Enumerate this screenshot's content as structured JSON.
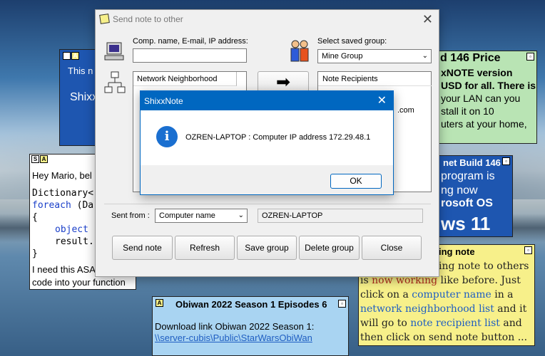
{
  "main_dialog": {
    "title": "Send note to other",
    "comp_label": "Comp. name, E-mail, IP address:",
    "comp_value": "",
    "saved_group_label": "Select saved group:",
    "saved_group_value": "Mine Group",
    "network_header": "Network Neighborhood",
    "recipients_header": "Note Recipients",
    "recipients_partial": ".com",
    "sent_from_label": "Sent from :",
    "sent_from_value": "Computer name",
    "sent_from_computer": "OZREN-LAPTOP",
    "buttons": {
      "send": "Send note",
      "refresh": "Refresh",
      "save_group": "Save group",
      "delete_group": "Delete group",
      "close": "Close"
    }
  },
  "message_box": {
    "title": "ShixxNote",
    "message": "OZREN-LAPTOP : Computer IP address 172.29.48.1",
    "ok": "OK"
  },
  "notes": {
    "blue_left": {
      "line1": "This n",
      "line2": "Shixx"
    },
    "green_right": {
      "title": "d 146 Price",
      "lines": [
        "xNOTE version",
        "USD for all. There is",
        "your LAN can you",
        "stall it on 10",
        "uters at your home,"
      ]
    },
    "white_left": {
      "line1": "Hey Mario, bel",
      "code1": "Dictionary<",
      "code2_kw": "foreach",
      "code2_rest": " (Da",
      "code3": "{",
      "code4_kw": "object",
      "code5": "result.",
      "code6": "}",
      "line_end1": "I need this ASA",
      "line_end2": "code into your function ..."
    },
    "blue_right": {
      "title": "net Build 146",
      "line1": "program is",
      "line2": "ng now",
      "line3": "rosoft OS",
      "line4": "ws 11"
    },
    "yellow_right": {
      "title": "ing note",
      "seg_a": "ing note to others",
      "seg_b1": "is ",
      "seg_b2": "now working",
      "seg_b3": " like before. Just",
      "seg_c1": "click on a ",
      "seg_c2": "computer name",
      "seg_c3": " in a",
      "seg_d1": "network neighborhood list",
      "seg_d2": " and it",
      "seg_e1": "will go to ",
      "seg_e2": "note recipient list",
      "seg_e3": " and",
      "seg_f": "then click on send note button ..."
    },
    "cyan_bottom": {
      "title": "Obiwan 2022 Season 1 Episodes 6",
      "line1": "Download link Obiwan 2022 Season 1:",
      "link": "\\\\server-cubis\\Public\\StarWarsObiWan"
    }
  },
  "colors": {
    "note_blue": "#1e56b0",
    "note_green": "#b9e4b4",
    "note_yellow": "#f7f08a",
    "note_cyan": "#a9d4f2",
    "note_white": "#ffffff",
    "accent_blue": "#0067c0"
  }
}
